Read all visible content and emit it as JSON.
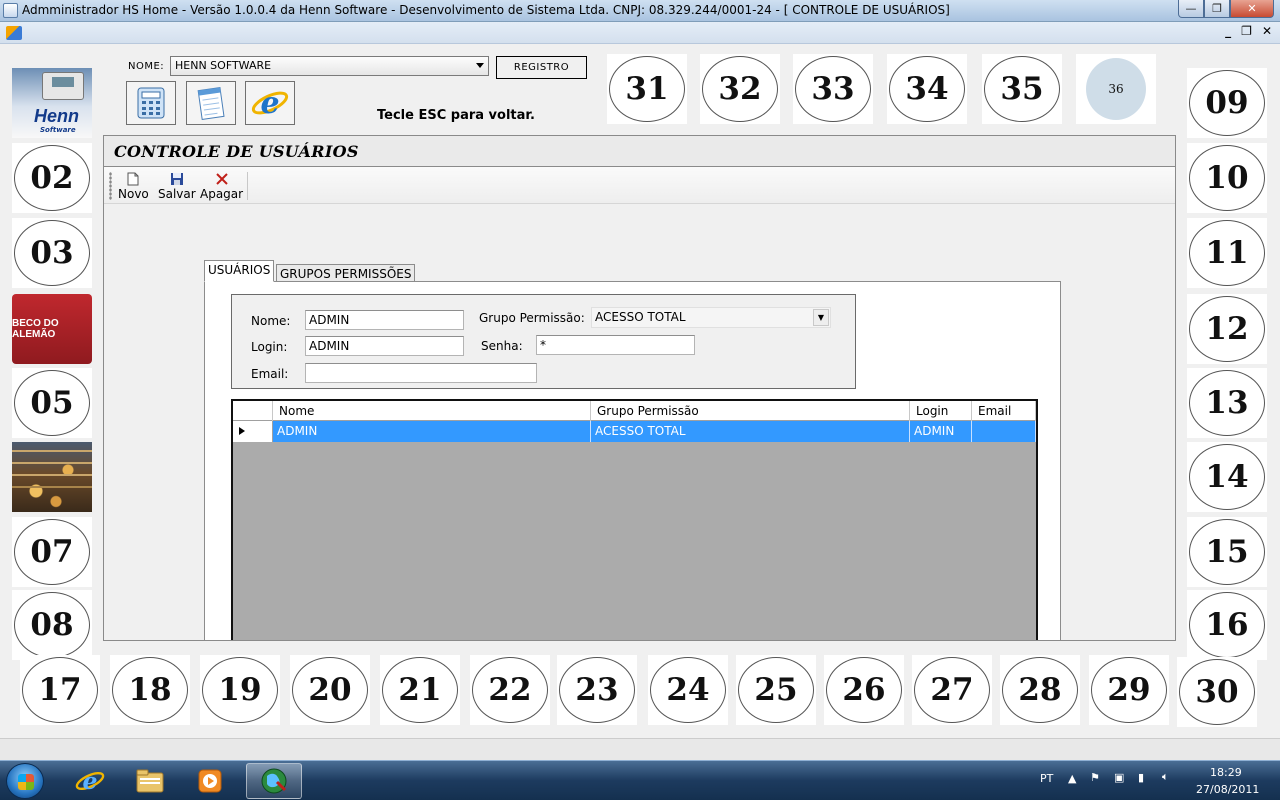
{
  "window": {
    "title": "Admministrador HS Home - Versão 1.0.0.4 da Henn Software - Desenvolvimento de Sistema Ltda. CNPJ: 08.329.244/0001-24 - [ CONTROLE DE USUÁRIOS]",
    "minimize": "—",
    "maximize": "❐",
    "close": "✕"
  },
  "mdi": {
    "minimize": "_",
    "restore": "❐",
    "close": "✕"
  },
  "top": {
    "nome_label": "NOME:",
    "nome_value": "HENN SOFTWARE",
    "registro_label": "REGISTRO",
    "hint": "Tecle ESC para voltar.",
    "tool_icons": [
      "calculator-icon",
      "notepad-icon",
      "internet-explorer-icon"
    ]
  },
  "tiles": {
    "left": [
      {
        "type": "logo",
        "name": "henn-logo",
        "text": "Henn",
        "sub": "Software"
      },
      {
        "type": "num",
        "label": "02"
      },
      {
        "type": "num",
        "label": "03"
      },
      {
        "type": "logo",
        "name": "beco-logo",
        "text": "BECO DO ALEMÃO"
      },
      {
        "type": "num",
        "label": "05"
      },
      {
        "type": "logo",
        "name": "mall-picture"
      },
      {
        "type": "num",
        "label": "07"
      },
      {
        "type": "num",
        "label": "08"
      }
    ],
    "right": [
      "09",
      "10",
      "11",
      "12",
      "13",
      "14",
      "15",
      "16"
    ],
    "top": [
      "31",
      "32",
      "33",
      "34",
      "35",
      "36"
    ],
    "bottom": [
      "17",
      "18",
      "19",
      "20",
      "21",
      "22",
      "23",
      "24",
      "25",
      "26",
      "27",
      "28",
      "29",
      "30"
    ]
  },
  "child": {
    "title": "CONTROLE DE USUÁRIOS",
    "toolbar": {
      "novo": "Novo",
      "salvar": "Salvar",
      "apagar": "Apagar"
    },
    "tabs": [
      "USUÁRIOS",
      "GRUPOS PERMISSÕES"
    ],
    "form": {
      "nome_label": "Nome:",
      "nome_value": "ADMIN",
      "login_label": "Login:",
      "login_value": "ADMIN",
      "email_label": "Email:",
      "email_value": "",
      "grupo_label": "Grupo Permissão:",
      "grupo_value": "ACESSO TOTAL",
      "senha_label": "Senha:",
      "senha_value": "*"
    },
    "grid": {
      "columns": [
        "Nome",
        "Grupo Permissão",
        "Login",
        "Email"
      ],
      "rows": [
        {
          "nome": "ADMIN",
          "grupo": "ACESSO TOTAL",
          "login": "ADMIN",
          "email": ""
        }
      ]
    }
  },
  "taskbar": {
    "apps": [
      "internet-explorer-icon",
      "file-explorer-icon",
      "media-player-icon",
      "henn-app-icon"
    ],
    "language": "PT",
    "time": "18:29",
    "date": "27/08/2011"
  },
  "colors": {
    "selection": "#3399ff",
    "grid_bg": "#ababab",
    "title_gradient_top": "#cfe0f1"
  }
}
